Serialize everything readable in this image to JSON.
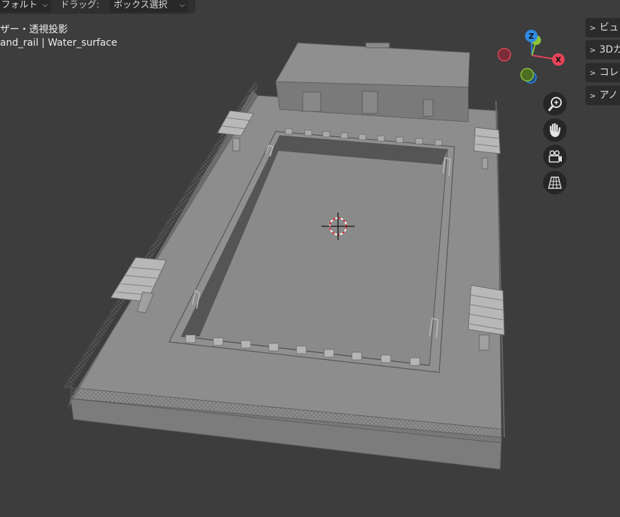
{
  "header": {
    "orientation_dropdown": "フォルト",
    "drag_label": "ドラッグ:",
    "drag_dropdown": "ボックス選択"
  },
  "viewport": {
    "view_title": "ザー・透視投影",
    "selection_info": "and_rail | Water_surface"
  },
  "gizmo": {
    "z_label": "Z",
    "x_label": "X",
    "colors": {
      "x": "#e8445a",
      "y": "#8bc43a",
      "z": "#2f8ae5"
    }
  },
  "nav_buttons": [
    "zoom-icon",
    "hand-pan-icon",
    "camera-icon",
    "grid-ortho-icon"
  ],
  "sidebar_tabs": [
    {
      "label": "ビュ"
    },
    {
      "label": "3Dカ"
    },
    {
      "label": "コレ"
    },
    {
      "label": "アノ"
    }
  ]
}
